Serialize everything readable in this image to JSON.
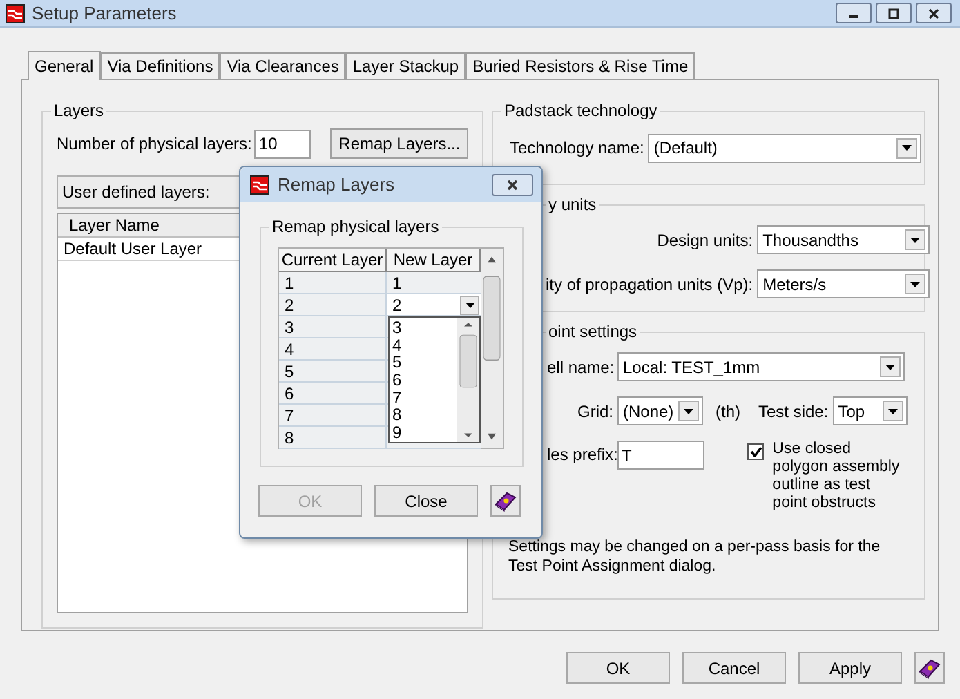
{
  "window": {
    "title": "Setup Parameters"
  },
  "tabs": [
    {
      "label": "General",
      "selected": true
    },
    {
      "label": "Via Definitions",
      "selected": false
    },
    {
      "label": "Via Clearances",
      "selected": false
    },
    {
      "label": "Layer Stackup",
      "selected": false
    },
    {
      "label": "Buried Resistors & Rise Time",
      "selected": false
    }
  ],
  "layers_group": {
    "title": "Layers",
    "count_label": "Number of physical layers:",
    "count_value": "10",
    "remap_button": "Remap Layers...",
    "user_defined_label": "User defined layers:",
    "table": {
      "columns": [
        "Layer Name"
      ],
      "rows": [
        "Default User Layer"
      ]
    }
  },
  "padstack": {
    "title": "Padstack technology",
    "label": "Technology name:",
    "value": "(Default)"
  },
  "units": {
    "title": "y units",
    "design_label": "Design units:",
    "design_value": "Thousandths",
    "vp_label": "ity of propagation units (Vp):",
    "vp_value": "Meters/s"
  },
  "test_point": {
    "title": "oint settings",
    "cell_label": "ell name:",
    "cell_value": "Local: TEST_1mm",
    "grid_label": "Grid:",
    "grid_value": "(None)",
    "grid_unit": "(th)",
    "side_label": "Test side:",
    "side_value": "Top",
    "prefix_label": "les prefix:",
    "prefix_value": "T",
    "obstruct": {
      "label": "Use closed polygon assembly outline as test point obstructs",
      "checked": true
    },
    "note": "Settings may be changed on a per-pass basis for the Test Point Assignment dialog."
  },
  "buttons": [
    {
      "label": "OK",
      "kind": "text"
    },
    {
      "label": "Cancel",
      "kind": "text"
    },
    {
      "label": "Apply",
      "kind": "text"
    },
    {
      "kind": "help"
    }
  ],
  "dialog": {
    "title": "Remap Layers",
    "group_title": "Remap physical layers",
    "columns": [
      "Current Layer",
      "New Layer"
    ],
    "rows": [
      {
        "current": "1",
        "new": "1",
        "kind": "text"
      },
      {
        "current": "2",
        "new": "2",
        "kind": "combo"
      },
      {
        "current": "3",
        "kind": "text"
      },
      {
        "current": "4",
        "kind": "text"
      },
      {
        "current": "5",
        "kind": "text"
      },
      {
        "current": "6",
        "kind": "text"
      },
      {
        "current": "7",
        "kind": "text"
      },
      {
        "current": "8",
        "kind": "text"
      }
    ],
    "dropdown_options": [
      "3",
      "4",
      "5",
      "6",
      "7",
      "8",
      "9"
    ],
    "buttons": [
      {
        "label": "OK",
        "kind": "text",
        "disabled": true
      },
      {
        "label": "Close",
        "kind": "text",
        "disabled": false
      },
      {
        "kind": "help",
        "disabled": false
      }
    ]
  }
}
